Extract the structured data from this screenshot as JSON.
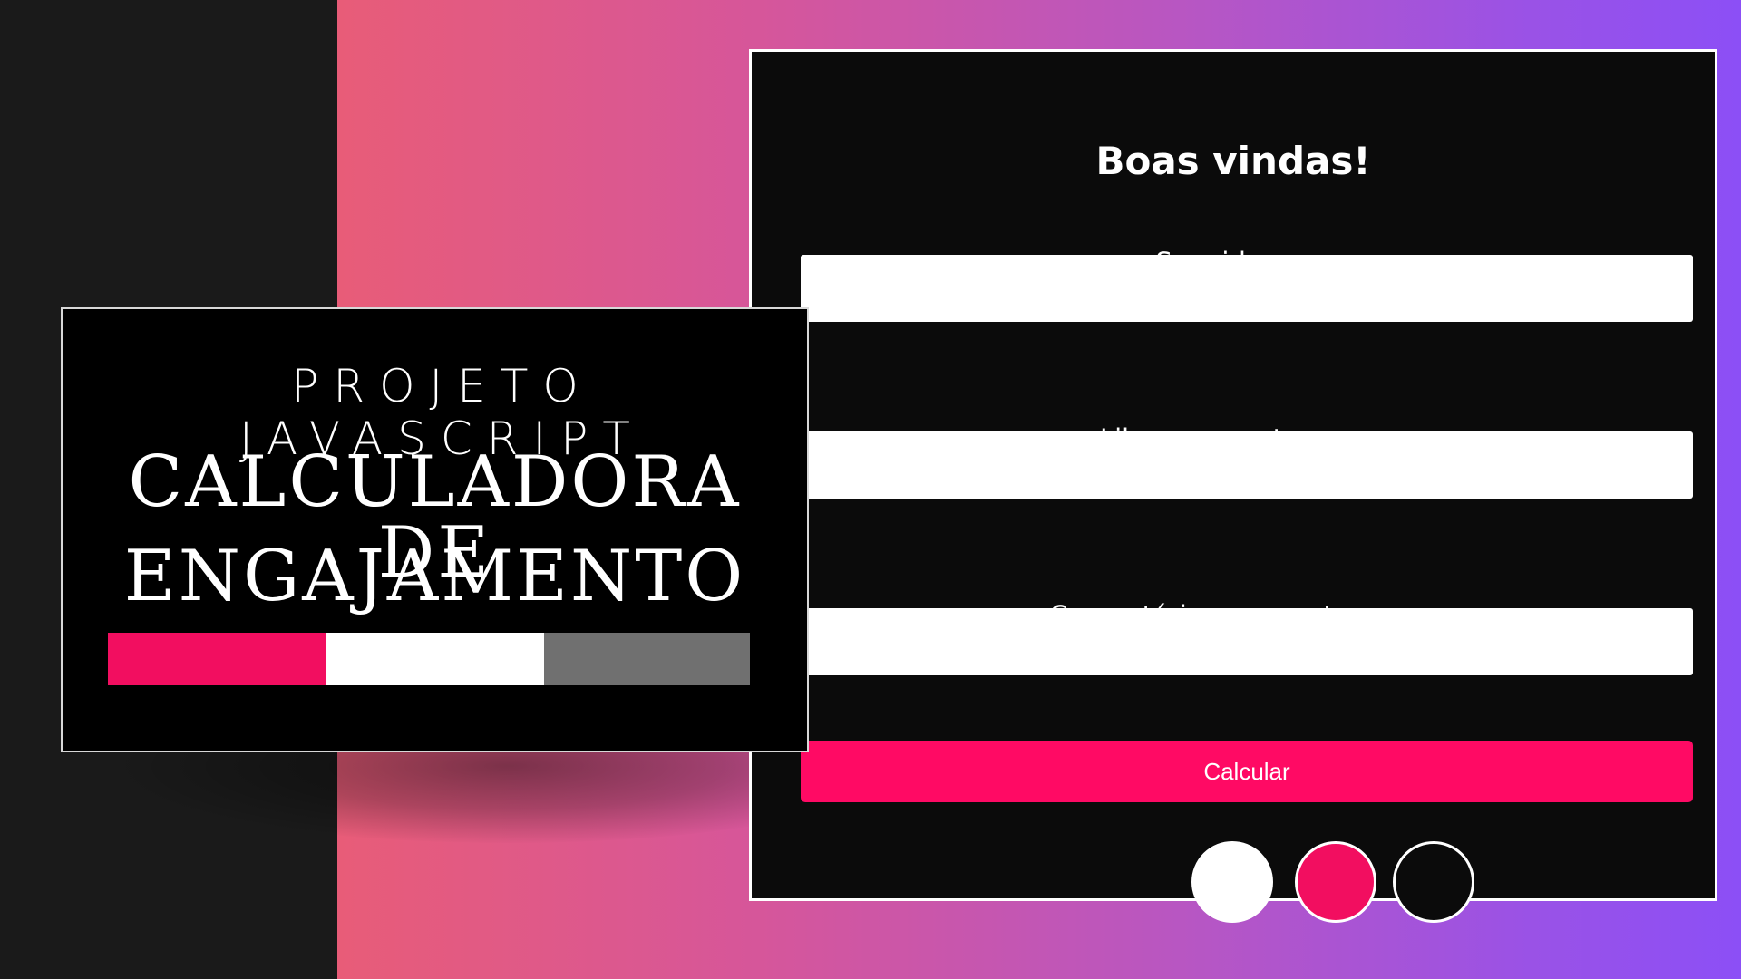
{
  "title_card": {
    "line1": "PROJETO JAVASCRIPT",
    "line2": "CALCULADORA DE",
    "line3": "ENGAJAMENTO",
    "bar_colors": [
      "#f20e60",
      "#ffffff",
      "#707070"
    ]
  },
  "form": {
    "title": "Boas vindas!",
    "fields": [
      {
        "label": "Seguidores:",
        "value": ""
      },
      {
        "label": "Likes por postagem:",
        "value": ""
      },
      {
        "label": "Comentários por postagem:",
        "value": ""
      }
    ],
    "button_label": "Calcular",
    "accent_color": "#ff0a64"
  },
  "palette": {
    "swatches": [
      "#ffffff",
      "#f20e60",
      "#0b0b0b"
    ]
  }
}
